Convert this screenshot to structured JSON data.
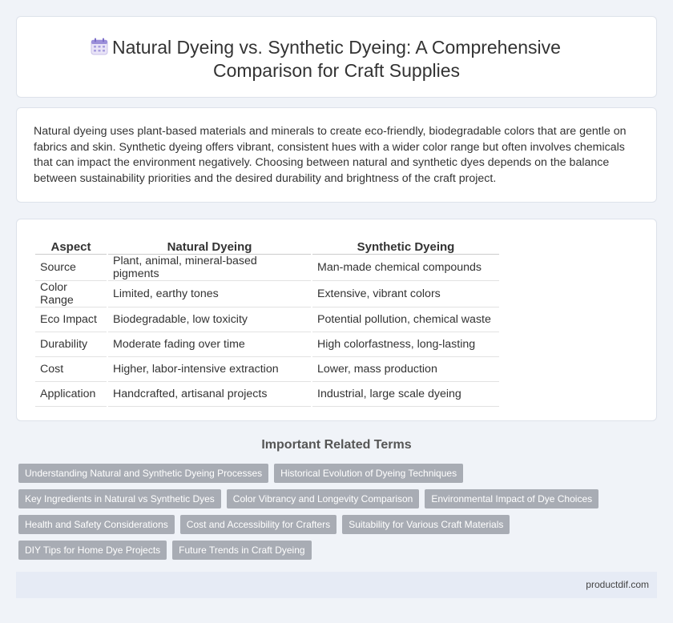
{
  "header": {
    "title": "Natural Dyeing vs. Synthetic Dyeing: A Comprehensive Comparison for Craft Supplies",
    "icon": "calendar-icon"
  },
  "intro": {
    "text": "Natural dyeing uses plant-based materials and minerals to create eco-friendly, biodegradable colors that are gentle on fabrics and skin. Synthetic dyeing offers vibrant, consistent hues with a wider color range but often involves chemicals that can impact the environment negatively. Choosing between natural and synthetic dyes depends on the balance between sustainability priorities and the desired durability and brightness of the craft project."
  },
  "table": {
    "headers": [
      "Aspect",
      "Natural Dyeing",
      "Synthetic Dyeing"
    ],
    "rows": [
      [
        "Source",
        "Plant, animal, mineral-based pigments",
        "Man-made chemical compounds"
      ],
      [
        "Color Range",
        "Limited, earthy tones",
        "Extensive, vibrant colors"
      ],
      [
        "Eco Impact",
        "Biodegradable, low toxicity",
        "Potential pollution, chemical waste"
      ],
      [
        "Durability",
        "Moderate fading over time",
        "High colorfastness, long-lasting"
      ],
      [
        "Cost",
        "Higher, labor-intensive extraction",
        "Lower, mass production"
      ],
      [
        "Application",
        "Handcrafted, artisanal projects",
        "Industrial, large scale dyeing"
      ]
    ]
  },
  "related": {
    "heading": "Important Related Terms",
    "rows": [
      [
        "Understanding Natural and Synthetic Dyeing Processes",
        "Historical Evolution of Dyeing Techniques"
      ],
      [
        "Key Ingredients in Natural vs Synthetic Dyes",
        "Color Vibrancy and Longevity Comparison",
        "Environmental Impact of Dye Choices"
      ],
      [
        "Health and Safety Considerations",
        "Cost and Accessibility for Crafters",
        "Suitability for Various Craft Materials"
      ],
      [
        "DIY Tips for Home Dye Projects",
        "Future Trends in Craft Dyeing"
      ]
    ]
  },
  "footer": {
    "text": "productdif.com"
  },
  "colors": {
    "background": "#f0f3f8",
    "tag": "#a8acb4",
    "footer": "#e6ebf5"
  }
}
